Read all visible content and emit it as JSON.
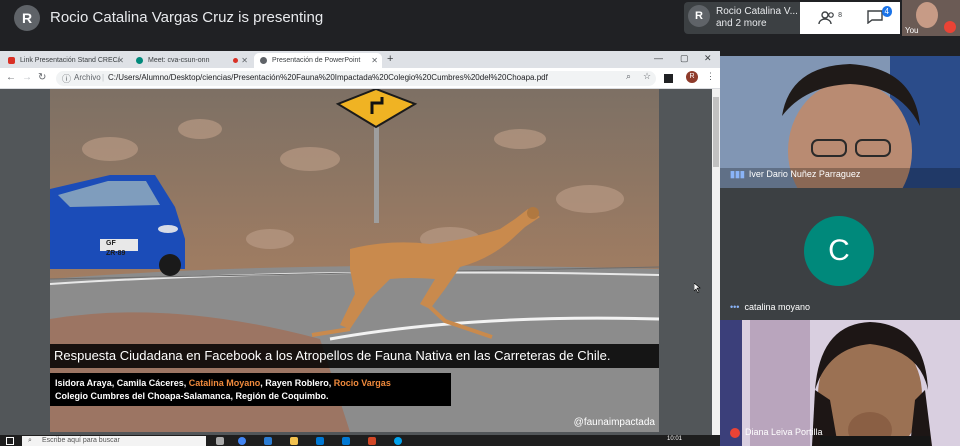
{
  "meet": {
    "presenter_initial": "R",
    "presenting_text": "Rocio Catalina Vargas Cruz is presenting",
    "presenter_card": {
      "initial": "R",
      "line1": "Rocio Catalina V...",
      "line2": "and 2 more"
    },
    "people_count": "8",
    "chat_badge": "4",
    "self_label": "You"
  },
  "browser": {
    "tabs": [
      {
        "label": "Link Presentación Stand CREC/",
        "favicon_color": "#d93025"
      },
      {
        "label": "Meet: cva-csun-onn",
        "favicon_color": "#00897b"
      },
      {
        "label": "Presentación de PowerPoint",
        "favicon_color": "#5f6368"
      }
    ],
    "window_controls": {
      "minimize": "—",
      "maximize": "▢",
      "close": "✕"
    },
    "address": {
      "site_label": "Archivo",
      "url": "C:/Users/Alumno/Desktop/ciencias/Presentación%20Fauna%20Impactada%20Colegio%20Cumbres%20del%20Choapa.pdf"
    },
    "profile_initial": "R"
  },
  "slide": {
    "caption": "Respuesta Ciudadana en Facebook a los Atropellos de Fauna Nativa en las Carreteras de Chile.",
    "authors": {
      "a1": "Isidora Araya, Camila Cáceres, ",
      "a2": "Catalina Moyano",
      "a3": ", Rayen Roblero, ",
      "a4": "Rocio Vargas",
      "line2": "Colegio Cumbres del Choapa-Salamanca, Región de Coquimbo."
    },
    "watermark": "@faunaimpactada",
    "license_plate": "GF ZR·89"
  },
  "participants": [
    {
      "name": "Iver Dario Nuñez Parraguez"
    },
    {
      "name": "catalina moyano",
      "initial": "C"
    },
    {
      "name": "Diana Leiva Portilla"
    }
  ],
  "taskbar": {
    "search_placeholder": "Escribe aquí para buscar",
    "time": "10:01"
  }
}
